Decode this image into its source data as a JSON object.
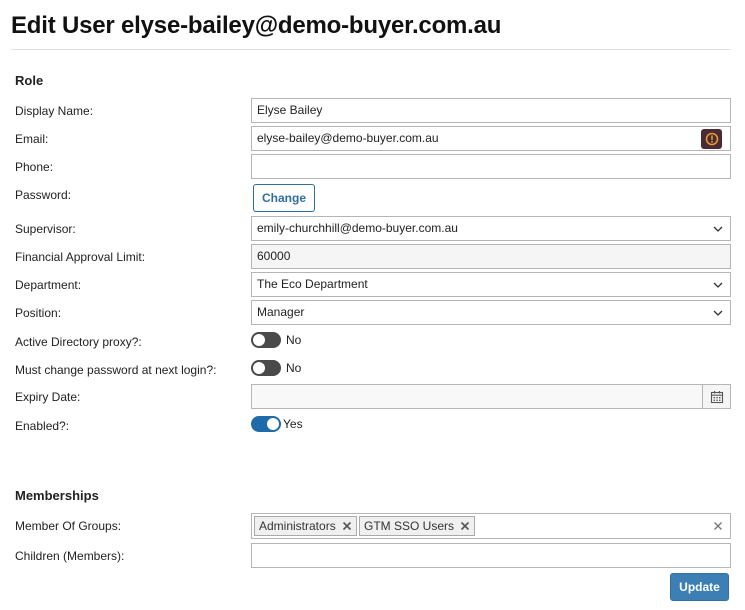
{
  "page": {
    "title": "Edit User elyse-bailey@demo-buyer.com.au"
  },
  "role_section": {
    "heading": "Role",
    "display_name": {
      "label": "Display Name:",
      "value": "Elyse Bailey"
    },
    "email": {
      "label": "Email:",
      "value": "elyse-bailey@demo-buyer.com.au",
      "icon": "warning-icon"
    },
    "phone": {
      "label": "Phone:",
      "value": ""
    },
    "password": {
      "label": "Password:",
      "button_label": "Change"
    },
    "supervisor": {
      "label": "Supervisor:",
      "value": "emily-churchhill@demo-buyer.com.au"
    },
    "financial_limit": {
      "label": "Financial Approval Limit:",
      "value": "60000"
    },
    "department": {
      "label": "Department:",
      "value": "The Eco Department"
    },
    "position": {
      "label": "Position:",
      "value": "Manager"
    },
    "ad_proxy": {
      "label": "Active Directory proxy?:",
      "state_label": "No",
      "on": false
    },
    "must_change_password": {
      "label": "Must change password at next login?:",
      "state_label": "No",
      "on": false
    },
    "expiry_date": {
      "label": "Expiry Date:",
      "value": ""
    },
    "enabled": {
      "label": "Enabled?:",
      "state_label": "Yes",
      "on": true
    }
  },
  "memberships_section": {
    "heading": "Memberships",
    "member_of_groups": {
      "label": "Member Of Groups:",
      "tags": [
        "Administrators",
        "GTM SSO Users"
      ]
    },
    "children": {
      "label": "Children (Members):",
      "value": ""
    }
  },
  "actions": {
    "update_label": "Update"
  },
  "colors": {
    "accent": "#3c7fb5",
    "toggle_on": "#1f6aa8",
    "toggle_off": "#4a4a4a",
    "warning_button": "#4a2a36",
    "warning_icon": "#e39b2d"
  }
}
